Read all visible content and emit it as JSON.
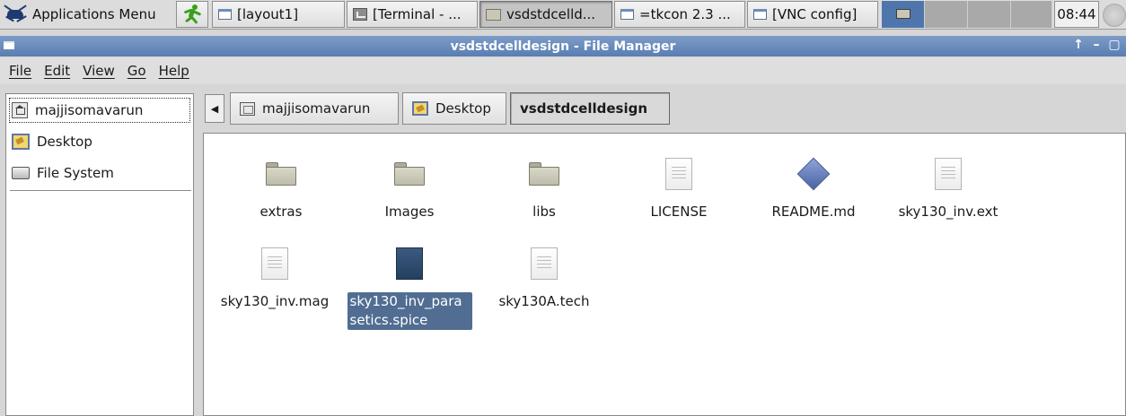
{
  "taskbar": {
    "apps_menu": "Applications Menu",
    "tasks": [
      {
        "label": "[layout1]"
      },
      {
        "label": "[Terminal - ..."
      },
      {
        "label": "vsdstdcelld..."
      },
      {
        "label": "=tkcon 2.3 ..."
      },
      {
        "label": "[VNC config]"
      }
    ],
    "clock": "08:44"
  },
  "window": {
    "title": "vsdstdcelldesign - File Manager",
    "controls": [
      "↑",
      "–",
      "▢"
    ]
  },
  "menubar": [
    "File",
    "Edit",
    "View",
    "Go",
    "Help"
  ],
  "sidebar": {
    "items": [
      {
        "label": "majjisomavarun",
        "icon": "home-folder-icon"
      },
      {
        "label": "Desktop",
        "icon": "desktop-icon"
      },
      {
        "label": "File System",
        "icon": "drive-icon"
      }
    ]
  },
  "pathbar": {
    "crumbs": [
      {
        "label": "majjisomavarun"
      },
      {
        "label": "Desktop"
      },
      {
        "label": "vsdstdcelldesign"
      }
    ]
  },
  "files": [
    {
      "name": "extras",
      "type": "folder"
    },
    {
      "name": "Images",
      "type": "folder"
    },
    {
      "name": "libs",
      "type": "folder"
    },
    {
      "name": "LICENSE",
      "type": "text"
    },
    {
      "name": "README.md",
      "type": "markdown"
    },
    {
      "name": "sky130_inv.ext",
      "type": "text"
    },
    {
      "name": "sky130_inv.mag",
      "type": "text"
    },
    {
      "name": "sky130_inv_parasetics.spice",
      "name_line1": "sky130_inv_para",
      "name_line2": "setics.spice",
      "type": "spice",
      "selected": true
    },
    {
      "name": "sky130A.tech",
      "type": "text"
    }
  ]
}
